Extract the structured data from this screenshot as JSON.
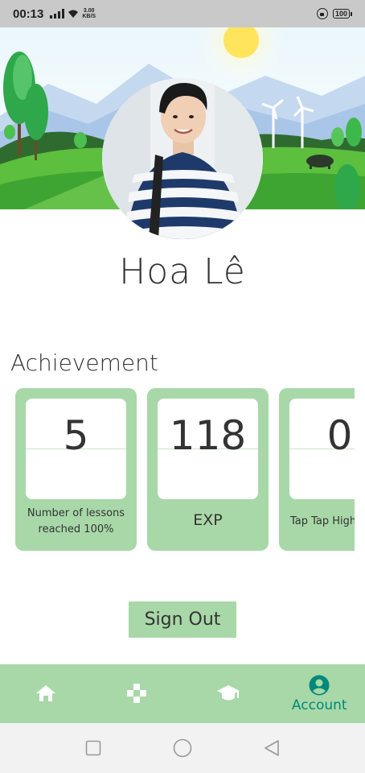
{
  "status_bar": {
    "time": "00:13",
    "net_speed_value": "3.00",
    "net_speed_unit": "KB/S",
    "battery": "100"
  },
  "profile": {
    "name": "Hoa Lê"
  },
  "achievement": {
    "title": "Achievement",
    "cards": [
      {
        "value": "5",
        "label": "Number of lessons reached 100%"
      },
      {
        "value": "118",
        "label": "EXP"
      },
      {
        "value": "0",
        "label": "Tap Tap High"
      }
    ]
  },
  "actions": {
    "sign_out_label": "Sign Out"
  },
  "bottom_nav": {
    "items": [
      {
        "icon": "home-icon",
        "label": ""
      },
      {
        "icon": "gamepad-icon",
        "label": ""
      },
      {
        "icon": "graduation-cap-icon",
        "label": ""
      },
      {
        "icon": "account-circle-icon",
        "label": "Account",
        "active": true
      }
    ]
  },
  "colors": {
    "accent_green": "#a8d8a8",
    "active_teal": "#00897b",
    "text_dark": "#333333"
  }
}
